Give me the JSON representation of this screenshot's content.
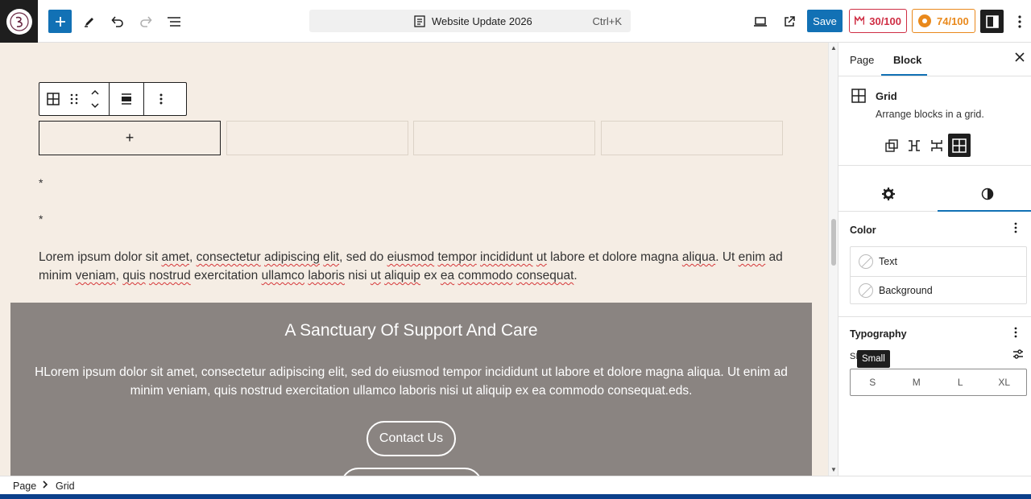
{
  "topbar": {
    "command_title": "Website Update 2026",
    "command_shortcut": "Ctrl+K",
    "save_label": "Save",
    "score_a": "30/100",
    "score_b": "74/100"
  },
  "editor": {
    "asterisk_1": "*",
    "asterisk_2": "*",
    "paragraph": [
      {
        "t": "Lorem ipsum dolor sit ",
        "s": false
      },
      {
        "t": "amet",
        "s": true
      },
      {
        "t": ", ",
        "s": false
      },
      {
        "t": "consectetur",
        "s": true
      },
      {
        "t": " ",
        "s": false
      },
      {
        "t": "adipiscing",
        "s": true
      },
      {
        "t": " ",
        "s": false
      },
      {
        "t": "elit",
        "s": true
      },
      {
        "t": ", sed do ",
        "s": false
      },
      {
        "t": "eiusmod",
        "s": true
      },
      {
        "t": " ",
        "s": false
      },
      {
        "t": "tempor",
        "s": true
      },
      {
        "t": " ",
        "s": false
      },
      {
        "t": "incididunt",
        "s": true
      },
      {
        "t": " ",
        "s": false
      },
      {
        "t": "ut",
        "s": true
      },
      {
        "t": " labore et dolore magna ",
        "s": false
      },
      {
        "t": "aliqua",
        "s": true
      },
      {
        "t": ". Ut ",
        "s": false
      },
      {
        "t": "enim",
        "s": true
      },
      {
        "t": " ad minim ",
        "s": false
      },
      {
        "t": "veniam",
        "s": true
      },
      {
        "t": ", ",
        "s": false
      },
      {
        "t": "quis",
        "s": true
      },
      {
        "t": " ",
        "s": false
      },
      {
        "t": "nostrud",
        "s": true
      },
      {
        "t": " exercitation ",
        "s": false
      },
      {
        "t": "ullamco",
        "s": true
      },
      {
        "t": " ",
        "s": false
      },
      {
        "t": "laboris",
        "s": true
      },
      {
        "t": " nisi ",
        "s": false
      },
      {
        "t": "ut",
        "s": true
      },
      {
        "t": " ",
        "s": false
      },
      {
        "t": "aliquip",
        "s": true
      },
      {
        "t": " ex ",
        "s": false
      },
      {
        "t": "ea",
        "s": true
      },
      {
        "t": " ",
        "s": false
      },
      {
        "t": "commodo",
        "s": true
      },
      {
        "t": " ",
        "s": false
      },
      {
        "t": "consequat",
        "s": true
      },
      {
        "t": ".",
        "s": false
      }
    ],
    "cover_title": "A Sanctuary Of Support And Care",
    "cover_text": "HLorem ipsum dolor sit amet, consectetur adipiscing elit, sed do eiusmod tempor incididunt ut labore et dolore magna aliqua. Ut enim ad minim veniam, quis nostrud exercitation ullamco laboris nisi ut aliquip ex ea commodo consequat.eds.",
    "contact_label": "Contact Us",
    "add_symbol": "+"
  },
  "panel": {
    "tab_page": "Page",
    "tab_block": "Block",
    "block_title": "Grid",
    "block_desc": "Arrange blocks in a grid.",
    "color_title": "Color",
    "color_items": [
      "Text",
      "Background"
    ],
    "typography_title": "Typography",
    "size_label_partial": "SI",
    "tooltip": "Small",
    "size_options": [
      "S",
      "M",
      "L",
      "XL"
    ]
  },
  "footer": {
    "crumbs": [
      "Page",
      "Grid"
    ]
  },
  "colors": {
    "accent": "#1271b5",
    "canvas_bg": "#f5ede4",
    "cover_bg": "#8a8481",
    "score_a": "#cf2e44",
    "score_b": "#e9891c"
  }
}
